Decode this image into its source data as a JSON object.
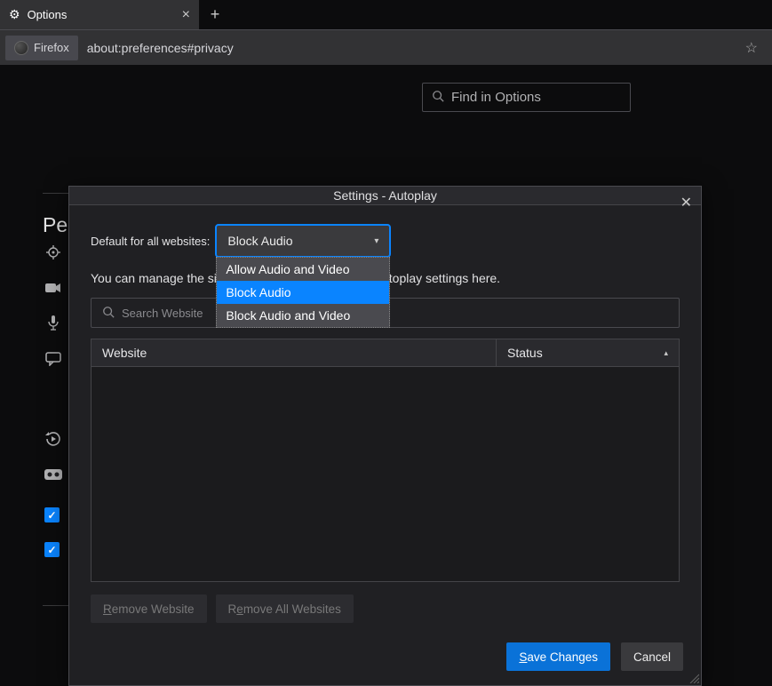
{
  "tab": {
    "title": "Options"
  },
  "urlbar": {
    "browser_label": "Firefox",
    "url": "about:preferences#privacy"
  },
  "search_page": {
    "placeholder": "Find in Options"
  },
  "permissions": {
    "heading_partial": "Pe"
  },
  "dialog": {
    "title": "Settings - Autoplay",
    "default_label": "Default for all websites:",
    "default_value": "Block Audio",
    "options": [
      "Allow Audio and Video",
      "Block Audio",
      "Block Audio and Video"
    ],
    "desc_pre": "You can manage the site",
    "desc_post": "utoplay settings here.",
    "search_placeholder": "Search Website",
    "col_website": "Website",
    "col_status": "Status",
    "remove_website": "Remove Website",
    "remove_all": "Remove All Websites",
    "save": "Save Changes",
    "cancel": "Cancel"
  }
}
